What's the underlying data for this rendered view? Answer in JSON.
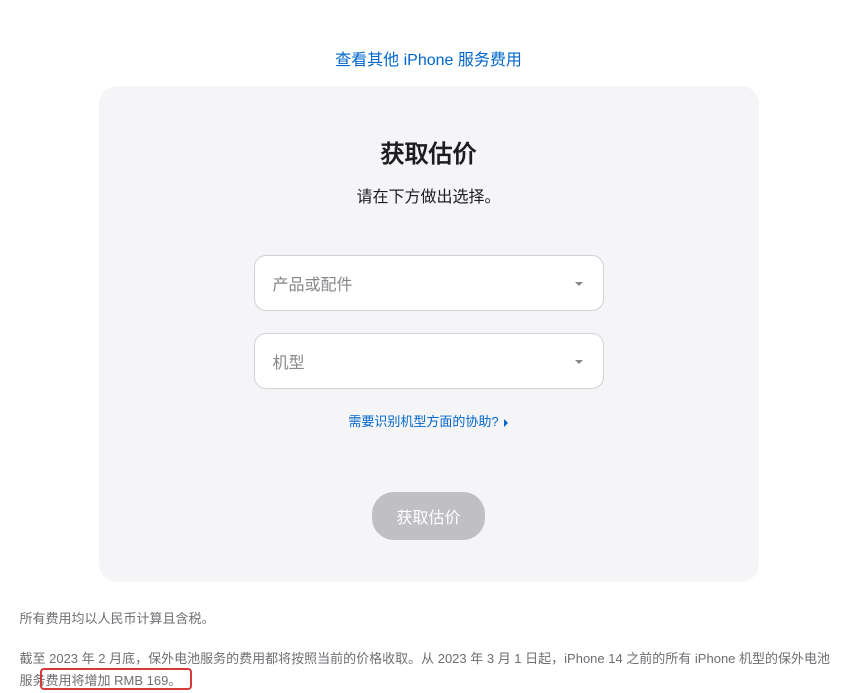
{
  "topLink": "查看其他 iPhone 服务费用",
  "card": {
    "title": "获取估价",
    "subtitle": "请在下方做出选择。",
    "selectProduct": "产品或配件",
    "selectModel": "机型",
    "helpLink": "需要识别机型方面的协助?",
    "button": "获取估价"
  },
  "notes": {
    "note1": "所有费用均以人民币计算且含税。",
    "note2": "截至 2023 年 2 月底，保外电池服务的费用都将按照当前的价格收取。从 2023 年 3 月 1 日起，iPhone 14 之前的所有 iPhone 机型的保外电池服务费用将增加 RMB 169。"
  }
}
